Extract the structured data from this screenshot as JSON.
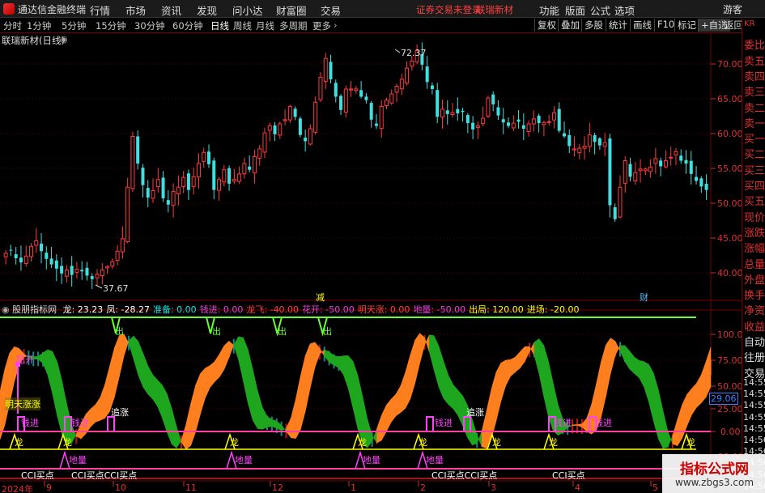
{
  "app": {
    "title": "通达信金融终端"
  },
  "menu": [
    "行情",
    "市场",
    "资讯",
    "发现",
    "问小达",
    "财富圈",
    "交易"
  ],
  "notice": {
    "trade": "证券交易未登录",
    "stock": "联瑞新材"
  },
  "right_menu": [
    "功能",
    "版面",
    "公式",
    "选项"
  ],
  "guest": "游客",
  "periods": [
    "分时",
    "1分钟",
    "5分钟",
    "15分钟",
    "30分钟",
    "60分钟",
    "日线",
    "周线",
    "月线",
    "多周期",
    "更多"
  ],
  "active_period": "日线",
  "right_toolbar": [
    "复权",
    "叠加",
    "多股",
    "统计",
    "画线",
    "F10",
    "标记",
    "+自选",
    "返回"
  ],
  "chart_title": "联瑞新材(日线)",
  "price_axis": [
    "70.00",
    "65.00",
    "60.00",
    "55.00",
    "50.00",
    "45.00",
    "40.00"
  ],
  "price_high_label": "72.37",
  "price_low_label": "37.67",
  "event_labels": {
    "jian": "减",
    "cai": "财"
  },
  "indicator": {
    "name": "股朋指标网",
    "items": [
      {
        "label": "龙:",
        "value": "23.23",
        "color": "#ffffff"
      },
      {
        "label": "凤:",
        "value": "-28.27",
        "color": "#ffffff"
      },
      {
        "label": "准备:",
        "value": "0.00",
        "color": "#00e5e5"
      },
      {
        "label": "钱进:",
        "value": "0.00",
        "color": "#e040e0"
      },
      {
        "label": "龙飞:",
        "value": "-40.00",
        "color": "#ff4040"
      },
      {
        "label": "花开:",
        "value": "-50.00",
        "color": "#e040e0"
      },
      {
        "label": "明天涨:",
        "value": "0.00",
        "color": "#ff4040"
      },
      {
        "label": "地量:",
        "value": "-50.00",
        "color": "#e040e0"
      },
      {
        "label": "出局:",
        "value": "120.00",
        "color": "#ffff00"
      },
      {
        "label": "进场:",
        "value": "-20.00",
        "color": "#ffff00"
      }
    ]
  },
  "ind_axis": [
    "100.00",
    "75.00",
    "50.00",
    "25.00",
    "0.00",
    "-25.00"
  ],
  "ind_current_value": "29.06",
  "ind_labels": {
    "huakai": "花开",
    "mingtianzhang": "明天涨涨",
    "qianjin": "钱进",
    "zhuizhang": "追涨",
    "long": "龙",
    "diliang": "地量",
    "cci": "CCI买点",
    "cci2": "CCI买点CCI买点",
    "cci3": "CCI买点CCI买点",
    "chu": "出"
  },
  "x_axis": [
    "2024年",
    "9",
    "10",
    "11",
    "12",
    "1",
    "2",
    "3",
    "4",
    "5"
  ],
  "side_panel": [
    "KR",
    "委比",
    "卖五",
    "卖四",
    "卖三",
    "卖二",
    "卖一",
    "买一",
    "买二",
    "买三",
    "买四",
    "买五",
    "现价",
    "涨跌",
    "涨幅",
    "总量",
    "外盘",
    "换手",
    "净资",
    "收益",
    "自动",
    "往册",
    "交易"
  ],
  "side_times": [
    "14:55",
    "14:55",
    "14:55",
    "14:55",
    "14:55",
    "14:56",
    "14:56",
    "14:56",
    "14:56",
    "14:56"
  ],
  "watermark": {
    "big": "指标公式网",
    "small": "www.zbgs3.com"
  },
  "colors": {
    "up": "#ff3c3c",
    "down": "#40e0e0",
    "orange": "#ff7f1e",
    "green": "#1fa61f",
    "magenta": "#ff40ff",
    "yellow": "#ffff00",
    "lime": "#66ff33"
  },
  "chart_data": {
    "type": "candlestick",
    "close": [
      42.8,
      43.2,
      42.1,
      41.5,
      42.4,
      43.8,
      44.6,
      43.1,
      42.0,
      41.2,
      40.6,
      39.9,
      40.4,
      39.7,
      40.5,
      40.2,
      39.6,
      39.1,
      39.8,
      40.4,
      40.9,
      41.6,
      43.1,
      44.9,
      52.3,
      59.6,
      55.7,
      52.6,
      50.8,
      51.8,
      53.4,
      50.7,
      49.8,
      51.7,
      52.3,
      53.7,
      51.9,
      53.8,
      55.7,
      57.3,
      55.6,
      51.9,
      53.4,
      54.8,
      52.8,
      53.4,
      54.2,
      55.7,
      54.8,
      56.7,
      57.8,
      60.1,
      61.1,
      59.9,
      61.4,
      62.0,
      63.9,
      62.4,
      59.8,
      58.9,
      60.7,
      64.5,
      68.1,
      70.8,
      67.8,
      65.3,
      63.4,
      66.4,
      66.4,
      66.4,
      65.3,
      64.8,
      62.0,
      61.1,
      63.9,
      64.8,
      65.7,
      66.8,
      67.8,
      69.4,
      70.4,
      71.9,
      69.9,
      67.4,
      66.4,
      62.4,
      63.5,
      62.8,
      63.0,
      62.9,
      63.1,
      61.5,
      60.6,
      61.1,
      62.2,
      65.1,
      64.2,
      62.6,
      61.6,
      61.1,
      61.5,
      61.7,
      60.7,
      61.4,
      62.1,
      61.5,
      61.6,
      61.7,
      63.0,
      60.4,
      59.6,
      58.2,
      57.8,
      57.9,
      58.2,
      59.8,
      58.8,
      58.3,
      58.7,
      49.7,
      47.7,
      52.3,
      56.1,
      53.8,
      54.4,
      54.9,
      54.9,
      55.2,
      56.4,
      55.3,
      56.1,
      56.6,
      57.4,
      56.1,
      55.7,
      54.2,
      53.2,
      52.4,
      51.9
    ]
  }
}
